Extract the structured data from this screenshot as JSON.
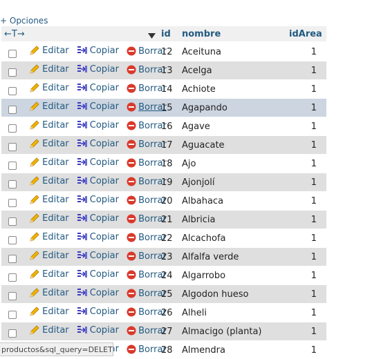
{
  "options_link": "+ Opciones",
  "header": {
    "arrows": "←T→",
    "sort_icon": "triangle-down-icon",
    "col_id": "id",
    "col_nombre": "nombre",
    "col_idarea": "idArea"
  },
  "actions": {
    "edit": "Editar",
    "copy": "Copiar",
    "delete": "Borrar"
  },
  "rows": [
    {
      "id": "12",
      "nombre": "Aceituna",
      "idArea": "1"
    },
    {
      "id": "13",
      "nombre": "Acelga",
      "idArea": "1"
    },
    {
      "id": "14",
      "nombre": "Achiote",
      "idArea": "1"
    },
    {
      "id": "15",
      "nombre": "Agapando",
      "idArea": "1"
    },
    {
      "id": "16",
      "nombre": "Agave",
      "idArea": "1"
    },
    {
      "id": "17",
      "nombre": "Aguacate",
      "idArea": "1"
    },
    {
      "id": "18",
      "nombre": "Ajo",
      "idArea": "1"
    },
    {
      "id": "19",
      "nombre": "Ajonjolí",
      "idArea": "1"
    },
    {
      "id": "20",
      "nombre": "Albahaca",
      "idArea": "1"
    },
    {
      "id": "21",
      "nombre": "Albricia",
      "idArea": "1"
    },
    {
      "id": "22",
      "nombre": "Alcachofa",
      "idArea": "1"
    },
    {
      "id": "23",
      "nombre": "Alfalfa verde",
      "idArea": "1"
    },
    {
      "id": "24",
      "nombre": "Algarrobo",
      "idArea": "1"
    },
    {
      "id": "25",
      "nombre": "Algodon hueso",
      "idArea": "1"
    },
    {
      "id": "26",
      "nombre": "Alheli",
      "idArea": "1"
    },
    {
      "id": "27",
      "nombre": "Almacigo (planta)",
      "idArea": "1"
    },
    {
      "id": "28",
      "nombre": "Almendra",
      "idArea": "1"
    }
  ],
  "status_url": "productos&sql_query=DELETE..."
}
